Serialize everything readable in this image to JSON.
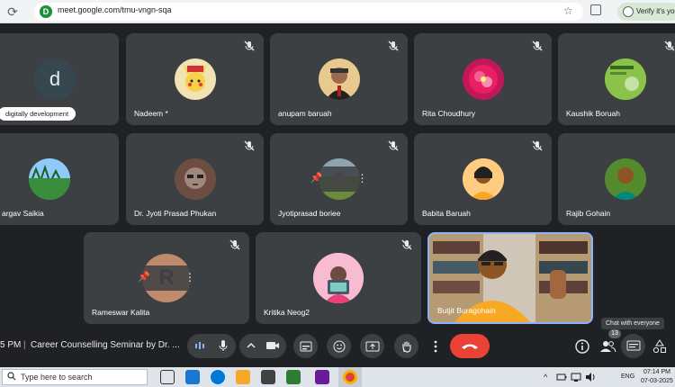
{
  "browser": {
    "url": "meet.google.com/tmu-vngn-sqa",
    "profile_label": "Verify it's you",
    "site_icon_letter": "D"
  },
  "tiles": [
    {
      "name": "",
      "avatar_letter": "d",
      "pill_label": "digitally development"
    },
    {
      "name": "Nadeem *",
      "avatar": "pikachu-avatar"
    },
    {
      "name": "anupam baruah",
      "avatar": "person-photo"
    },
    {
      "name": "Rita Choudhury",
      "avatar": "flower-photo"
    },
    {
      "name": "Kaushik Boruah",
      "avatar": "green-photo"
    },
    {
      "name": "argav Saikia",
      "avatar": "field-photo"
    },
    {
      "name": "Dr. Jyoti Prasad Phukan",
      "avatar": "person-photo"
    },
    {
      "name": "Jyotiprasad boriee",
      "avatar": "landscape-photo"
    },
    {
      "name": "Babita Baruah",
      "avatar": "person-photo"
    },
    {
      "name": "Rajib Gohain",
      "avatar": "person-photo"
    },
    {
      "name": "Rameswar Kalita",
      "avatar_letter": "R"
    },
    {
      "name": "Kritika Neog2",
      "avatar": "illustration"
    },
    {
      "name": "Butjit Buragohain",
      "avatar": "video"
    }
  ],
  "meeting_bar": {
    "time": "5 PM",
    "separator": "|",
    "title": "Career Counselling Seminar by Dr. ...",
    "chat_tooltip": "Chat with everyone",
    "participant_count": "13"
  },
  "taskbar": {
    "search_placeholder": "Type here to search",
    "lang": "ENG",
    "time": "07:14 PM",
    "date": "07-03-2025"
  },
  "colors": {
    "background": "#202124",
    "tile": "#3c4043",
    "end_call": "#ea4335",
    "active_border": "#8ab4f8"
  }
}
